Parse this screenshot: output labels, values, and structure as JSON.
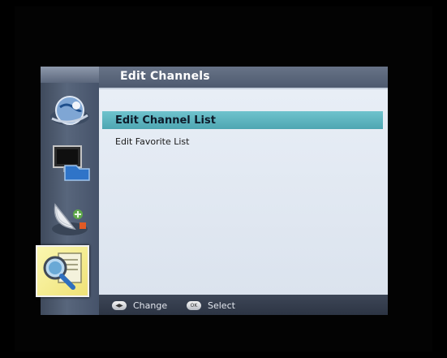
{
  "title": "Edit Channels",
  "menu": {
    "items": [
      {
        "label": "Edit Channel List",
        "selected": true
      },
      {
        "label": "Edit Favorite List",
        "selected": false
      }
    ]
  },
  "sidebar": {
    "icons": [
      {
        "name": "globe-satellite-icon",
        "selected": false
      },
      {
        "name": "monitor-folder-icon",
        "selected": false
      },
      {
        "name": "satellite-dish-icon",
        "selected": false
      },
      {
        "name": "magnifier-document-icon",
        "selected": true
      }
    ]
  },
  "footer": {
    "change_key": "◀▶",
    "change_label": "Change",
    "select_key": "OK",
    "select_label": "Select"
  },
  "colors": {
    "highlight": "#5fb7c1",
    "content_bg": "#e3e9f2",
    "bar_bg": "#4e5a6f",
    "selected_icon_bg": "#f5eb8e"
  }
}
